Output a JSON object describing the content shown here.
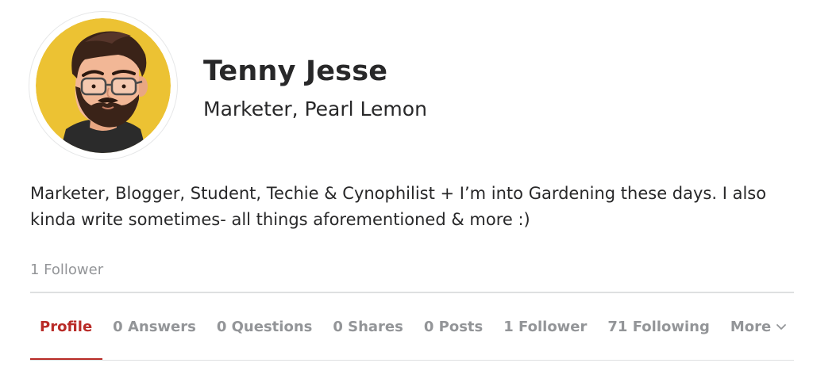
{
  "profile": {
    "name": "Tenny Jesse",
    "credential": "Marketer, Pearl Lemon",
    "bio": "Marketer, Blogger, Student, Techie & Cynophilist + I’m into Gardening these days. I also kinda write sometimes- all things aforementioned & more :)",
    "followers_label": "1 Follower"
  },
  "tabs": [
    {
      "label": "Profile",
      "active": true
    },
    {
      "label": "0 Answers"
    },
    {
      "label": "0 Questions"
    },
    {
      "label": "0 Shares"
    },
    {
      "label": "0 Posts"
    },
    {
      "label": "1 Follower"
    },
    {
      "label": "71 Following"
    },
    {
      "label": "More",
      "icon": "chevron-down-icon"
    }
  ],
  "colors": {
    "accent": "#b92b27",
    "avatar_bg": "#ecc233",
    "muted_text": "#939598"
  }
}
